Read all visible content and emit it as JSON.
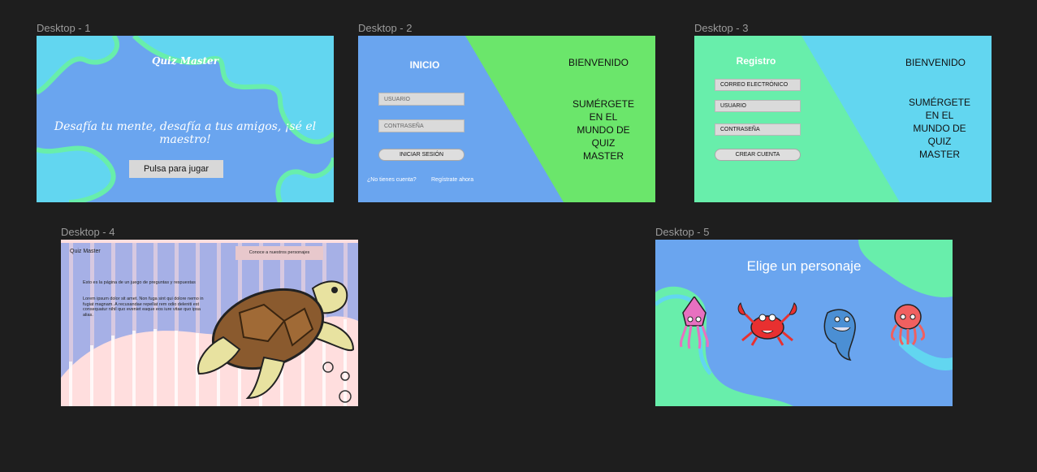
{
  "frames": {
    "d1": {
      "label": "Desktop - 1",
      "title": "Quiz Master",
      "tagline": "Desafía tu mente, desafía a tus amigos, ¡sé el maestro!",
      "button": "Pulsa para jugar"
    },
    "d2": {
      "label": "Desktop - 2",
      "heading": "INICIO",
      "user_placeholder": "USUARIO",
      "pass_placeholder": "CONTRASEÑA",
      "login_button": "INICIAR SESIÓN",
      "no_account": "¿No tienes cuenta?",
      "register_link": "Regístrate ahora",
      "welcome": "BIENVENIDO",
      "slogan": [
        "SUMÉRGETE",
        "EN EL",
        "MUNDO DE",
        "QUIZ",
        "MASTER"
      ]
    },
    "d3": {
      "label": "Desktop - 3",
      "heading": "Registro",
      "email_placeholder": "CORREO ELECTRÓNICO",
      "user_placeholder": "USUARIO",
      "pass_placeholder": "CONTRASEÑA",
      "create_button": "CREAR CUENTA",
      "welcome": "BIENVENIDO",
      "slogan": [
        "SUMÉRGETE",
        "EN EL",
        "MUNDO DE",
        "QUIZ",
        "MASTER"
      ]
    },
    "d4": {
      "label": "Desktop - 4",
      "brand": "Quiz Master",
      "characters_button": "Conoce a nuestros personajes",
      "intro": "Esto es la página de un juego de preguntas y respuestas",
      "lorem": "Lorem ipsum dolor sit amet. Non fuga sint qui dolore nemo in fugiat magnam. A recusandae repellat rem odio deleniti est consequatur nihil quo eveniet eaque eos iure vitae quo ipsa alias."
    },
    "d5": {
      "label": "Desktop - 5",
      "title": "Elige un personaje",
      "characters": [
        "squid",
        "crab",
        "dolphin",
        "octopus"
      ]
    }
  },
  "colors": {
    "canvas": "#1e1e1e",
    "blue": "#6aa5ef",
    "cyan": "#62d6f0",
    "green": "#6be66b",
    "mint": "#68eeab",
    "pink": "#ffdede",
    "lavender": "#a6b0e6"
  }
}
